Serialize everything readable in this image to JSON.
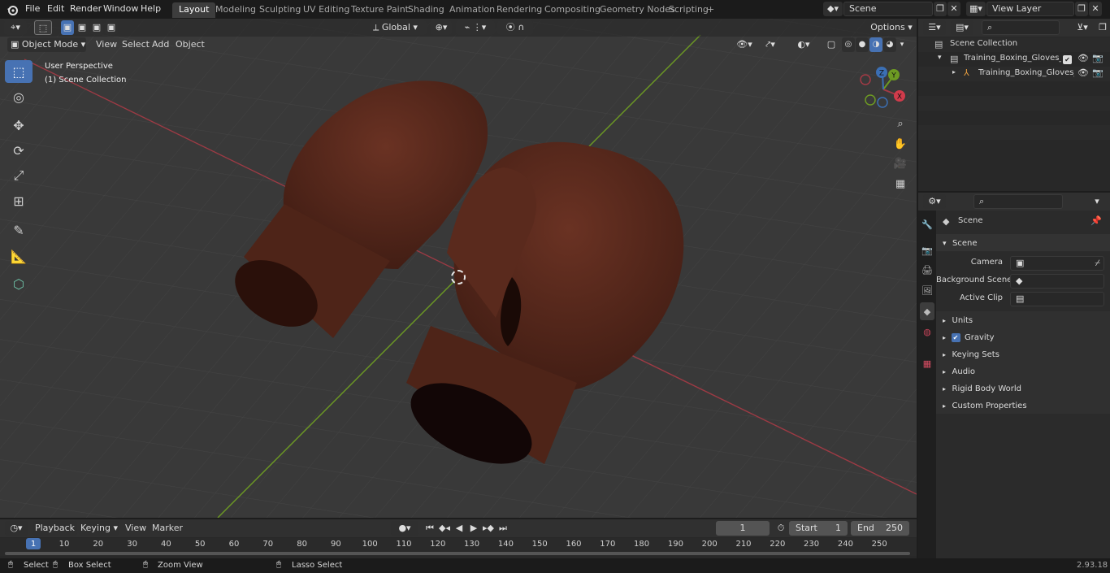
{
  "topbar": {
    "menus": [
      "File",
      "Edit",
      "Render",
      "Window",
      "Help"
    ],
    "workspaces": [
      "Layout",
      "Modeling",
      "Sculpting",
      "UV Editing",
      "Texture Paint",
      "Shading",
      "Animation",
      "Rendering",
      "Compositing",
      "Geometry Nodes",
      "Scripting"
    ],
    "active_workspace": "Layout",
    "add_tab": "+",
    "scene": "Scene",
    "view_layer": "View Layer"
  },
  "viewport": {
    "mode": "Object Mode",
    "menus": [
      "View",
      "Select",
      "Add",
      "Object"
    ],
    "transform_orientation": "Global",
    "options": "Options",
    "info_line1": "User Perspective",
    "info_line2": "(1) Scene Collection",
    "gizmo": {
      "x": "X",
      "y": "Y",
      "z": "Z"
    }
  },
  "outliner": {
    "root": "Scene Collection",
    "items": [
      {
        "label": "Training_Boxing_Gloves_Brov"
      },
      {
        "label": "Training_Boxing_Gloves_"
      }
    ]
  },
  "properties": {
    "header": "Scene",
    "panel_title": "Scene",
    "fields": [
      {
        "label": "Camera"
      },
      {
        "label": "Background Scene"
      },
      {
        "label": "Active Clip"
      }
    ],
    "sections": [
      "Units",
      "Gravity",
      "Keying Sets",
      "Audio",
      "Rigid Body World",
      "Custom Properties"
    ],
    "gravity_checked": true
  },
  "timeline": {
    "menus": [
      "Playback",
      "Keying",
      "View",
      "Marker"
    ],
    "current_frame": "1",
    "start_label": "Start",
    "start": "1",
    "end_label": "End",
    "end": "250",
    "ruler": [
      "1",
      "10",
      "20",
      "30",
      "40",
      "50",
      "60",
      "70",
      "80",
      "90",
      "100",
      "110",
      "120",
      "130",
      "140",
      "150",
      "160",
      "170",
      "180",
      "190",
      "200",
      "210",
      "220",
      "230",
      "240",
      "250"
    ]
  },
  "statusbar": {
    "select": "Select",
    "box_select": "Box Select",
    "zoom_view": "Zoom View",
    "lasso_select": "Lasso Select",
    "version": "2.93.18"
  },
  "colors": {
    "accent": "#4772b3",
    "glove": "#5a2a1d",
    "x_axis": "#a33a45",
    "y_axis": "#6d9a23"
  }
}
